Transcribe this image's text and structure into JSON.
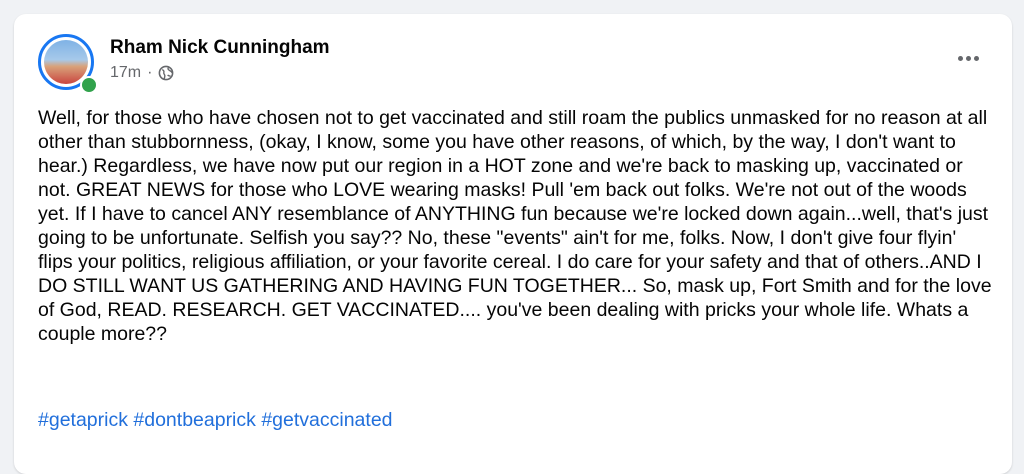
{
  "post": {
    "author": "Rham Nick Cunningham",
    "timestamp": "17m",
    "separator": "·",
    "privacy_icon": "globe-icon",
    "more_icon": "more-options-icon",
    "body": "Well, for those who have chosen not to get vaccinated and still roam the publics unmasked for no reason at all other than stubbornness, (okay, I know, some you have other reasons, of which, by the way, I don't want to hear.) Regardless, we have now put our region in a HOT zone and we're back to masking up, vaccinated or not. GREAT NEWS for those who LOVE wearing masks! Pull 'em back out folks. We're not out of the woods yet. If I have to cancel ANY resemblance of ANYTHING fun because we're locked down again...well, that's just going to be unfortunate. Selfish you say?? No, these \"events\" ain't for me, folks. Now, I don't give four flyin' flips your politics, religious affiliation, or your favorite cereal. I do care for your safety and that of others..AND I DO STILL WANT US GATHERING AND HAVING FUN TOGETHER... So, mask up, Fort Smith and for the love of God, READ. RESEARCH. GET VACCINATED.... you've been dealing with pricks your whole life. Whats a couple more??",
    "hashtags": [
      "#getaprick",
      "#dontbeaprick",
      "#getvaccinated"
    ]
  },
  "colors": {
    "background": "#f0f2f5",
    "card": "#ffffff",
    "text": "#050505",
    "secondary_text": "#65676b",
    "hashtag": "#216fdb",
    "avatar_ring": "#1877f2",
    "online": "#31a24c"
  }
}
